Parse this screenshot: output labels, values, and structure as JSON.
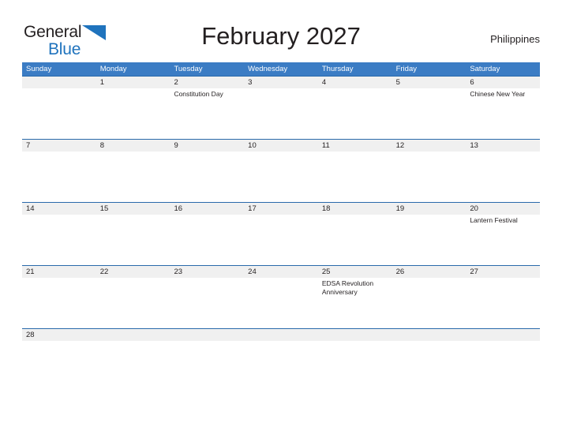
{
  "brand": {
    "name_part1": "General",
    "name_part2": "Blue",
    "accent_color": "#1f73bd"
  },
  "header": {
    "title": "February 2027",
    "country": "Philippines"
  },
  "theme": {
    "header_bg": "#3b7cc4",
    "date_band_bg": "#f0f0f0",
    "rule_color": "#2a6aab",
    "text_color": "#231f20"
  },
  "calendar": {
    "weekdays": [
      "Sunday",
      "Monday",
      "Tuesday",
      "Wednesday",
      "Thursday",
      "Friday",
      "Saturday"
    ],
    "weeks": [
      {
        "days": [
          {
            "num": "",
            "events": []
          },
          {
            "num": "1",
            "events": []
          },
          {
            "num": "2",
            "events": [
              "Constitution Day"
            ]
          },
          {
            "num": "3",
            "events": []
          },
          {
            "num": "4",
            "events": []
          },
          {
            "num": "5",
            "events": []
          },
          {
            "num": "6",
            "events": [
              "Chinese New Year"
            ]
          }
        ]
      },
      {
        "days": [
          {
            "num": "7",
            "events": []
          },
          {
            "num": "8",
            "events": []
          },
          {
            "num": "9",
            "events": []
          },
          {
            "num": "10",
            "events": []
          },
          {
            "num": "11",
            "events": []
          },
          {
            "num": "12",
            "events": []
          },
          {
            "num": "13",
            "events": []
          }
        ]
      },
      {
        "days": [
          {
            "num": "14",
            "events": []
          },
          {
            "num": "15",
            "events": []
          },
          {
            "num": "16",
            "events": []
          },
          {
            "num": "17",
            "events": []
          },
          {
            "num": "18",
            "events": []
          },
          {
            "num": "19",
            "events": []
          },
          {
            "num": "20",
            "events": [
              "Lantern Festival"
            ]
          }
        ]
      },
      {
        "days": [
          {
            "num": "21",
            "events": []
          },
          {
            "num": "22",
            "events": []
          },
          {
            "num": "23",
            "events": []
          },
          {
            "num": "24",
            "events": []
          },
          {
            "num": "25",
            "events": [
              "EDSA Revolution Anniversary"
            ]
          },
          {
            "num": "26",
            "events": []
          },
          {
            "num": "27",
            "events": []
          }
        ]
      },
      {
        "days": [
          {
            "num": "28",
            "events": []
          },
          {
            "num": "",
            "events": []
          },
          {
            "num": "",
            "events": []
          },
          {
            "num": "",
            "events": []
          },
          {
            "num": "",
            "events": []
          },
          {
            "num": "",
            "events": []
          },
          {
            "num": "",
            "events": []
          }
        ]
      }
    ]
  }
}
